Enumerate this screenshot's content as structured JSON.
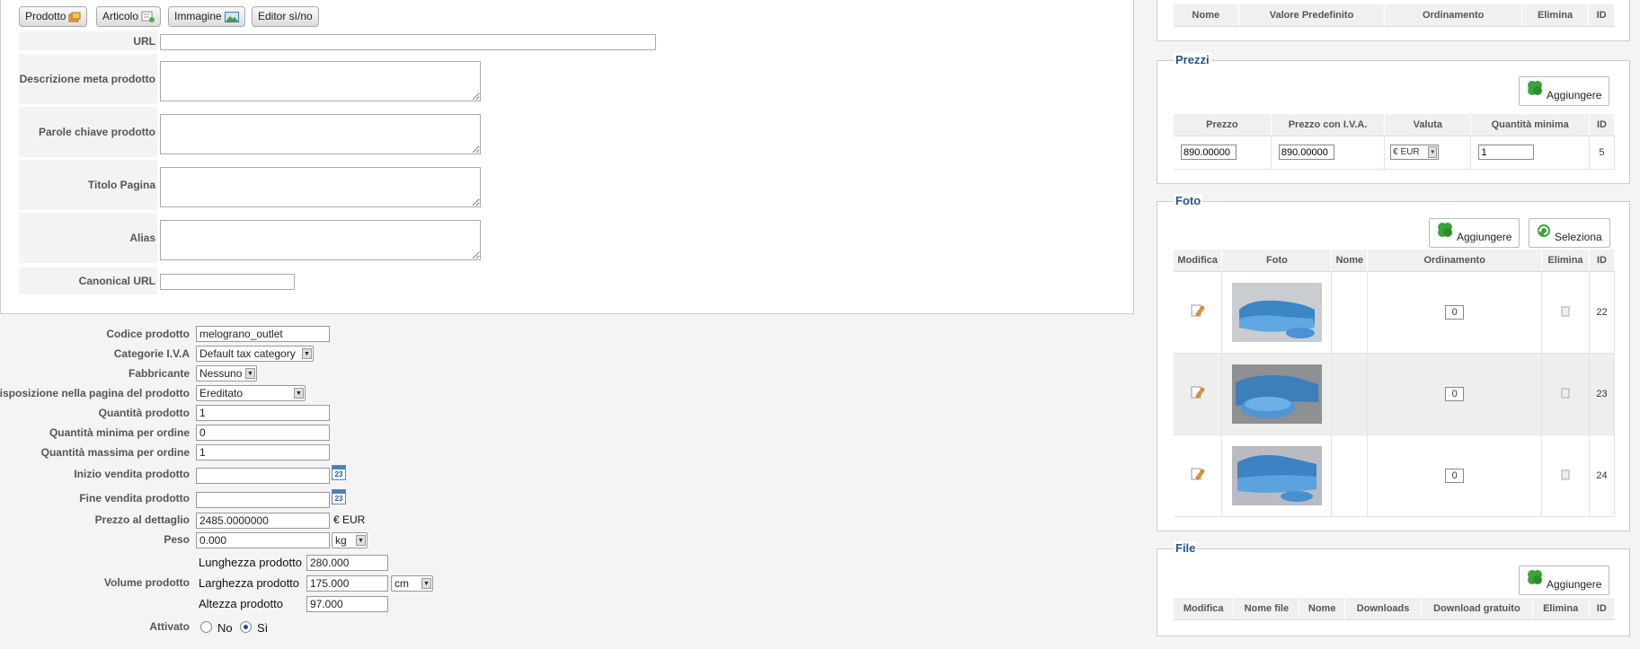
{
  "toolbar": {
    "prodotto": "Prodotto",
    "articolo": "Articolo",
    "immagine": "Immagine",
    "editor": "Editor sì/no"
  },
  "meta": {
    "url_label": "URL",
    "url_value": "",
    "descrizione_label": "Descrizione meta prodotto",
    "parole_label": "Parole chiave prodotto",
    "titolo_label": "Titolo Pagina",
    "alias_label": "Alias",
    "canonical_label": "Canonical URL",
    "canonical_value": ""
  },
  "fields": {
    "codice_label": "Codice prodotto",
    "codice_value": "melograno_outlet",
    "categorie_label": "Categorie I.V.A",
    "categorie_value": "Default tax category",
    "fabbricante_label": "Fabbricante",
    "fabbricante_value": "Nessuno",
    "disposizione_label": "Disposizione nella pagina del prodotto",
    "disposizione_value": "Ereditato",
    "quantita_label": "Quantità prodotto",
    "quantita_value": "1",
    "qmin_label": "Quantità minima per ordine",
    "qmin_value": "0",
    "qmax_label": "Quantità massima per ordine",
    "qmax_value": "1",
    "inizio_label": "Inizio vendita prodotto",
    "inizio_value": "",
    "fine_label": "Fine vendita prodotto",
    "fine_value": "",
    "calendar_day": "23",
    "prezzo_label": "Prezzo al dettaglio",
    "prezzo_value": "2485.0000000",
    "prezzo_currency": "€ EUR",
    "peso_label": "Peso",
    "peso_value": "0.000",
    "peso_unit": "kg",
    "volume_label": "Volume prodotto",
    "lunghezza_label": "Lunghezza prodotto",
    "lunghezza_value": "280.000",
    "larghezza_label": "Larghezza prodotto",
    "larghezza_value": "175.000",
    "altezza_label": "Altezza prodotto",
    "altezza_value": "97.000",
    "volume_unit": "cm",
    "attivato_label": "Attivato",
    "attivato_no": "No",
    "attivato_si": "Sì",
    "attivato_selected": "Sì"
  },
  "attributes": {
    "headers": [
      "Nome",
      "Valore Predefinito",
      "Ordinamento",
      "Elimina",
      "ID"
    ]
  },
  "prezzi": {
    "legend": "Prezzi",
    "add_label": "Aggiungere",
    "headers": [
      "Prezzo",
      "Prezzo con I.V.A.",
      "Valuta",
      "Quantità minima",
      "ID"
    ],
    "row": {
      "prezzo": "890.00000",
      "prezzo_iva": "890.00000",
      "valuta": "€ EUR",
      "qmin": "1",
      "id": "5"
    }
  },
  "foto": {
    "legend": "Foto",
    "add_label": "Aggiungere",
    "select_label": "Seleziona",
    "headers": [
      "Modifica",
      "Foto",
      "Nome",
      "Ordinamento",
      "Elimina",
      "ID"
    ],
    "rows": [
      {
        "nome": "",
        "ordinamento": "0",
        "id": "22"
      },
      {
        "nome": "",
        "ordinamento": "0",
        "id": "23"
      },
      {
        "nome": "",
        "ordinamento": "0",
        "id": "24"
      }
    ]
  },
  "file": {
    "legend": "File",
    "add_label": "Aggiungere",
    "headers": [
      "Modifica",
      "Nome file",
      "Nome",
      "Downloads",
      "Download gratuito",
      "Elimina",
      "ID"
    ]
  },
  "colors": {
    "legend_blue": "#22558d",
    "label_grey": "#555555",
    "add_green": "#3aa33a"
  }
}
